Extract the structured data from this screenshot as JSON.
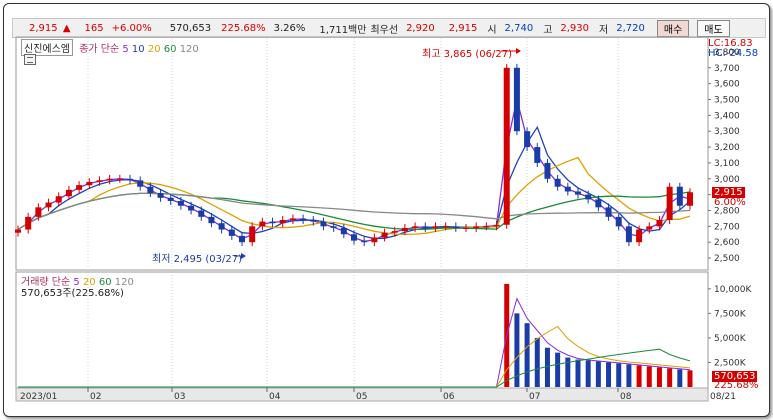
{
  "quote_bar": {
    "price": "2,915",
    "arrow": "▲",
    "change": "165",
    "change_pct": "+6.00%",
    "volume": "570,653",
    "volume_ratio": "225.68%",
    "turnover_pct": "3.26%",
    "amount": "1,711백만",
    "best_bid_label": "최우선",
    "best_ask": "2,920",
    "best_bid": "2,915",
    "open_label": "시",
    "open": "2,740",
    "high_label": "고",
    "high": "2,930",
    "low_label": "저",
    "low": "2,720",
    "buy_button": "매수",
    "sell_button": "매도"
  },
  "price_legend": {
    "stock_name": "신진에스엠",
    "ma_label": "종가 단순",
    "periods": [
      "5",
      "10",
      "20",
      "60",
      "120"
    ]
  },
  "lc_hc": {
    "lc": "LC:16.83",
    "hc": "HC:-24.58"
  },
  "annotations": {
    "high": "최고 3,865 (06/27)",
    "low": "최저 2,495 (03/27)"
  },
  "price_axis": {
    "ticks": [
      "3,800",
      "3,700",
      "3,600",
      "3,500",
      "3,400",
      "3,300",
      "3,200",
      "3,100",
      "3,000",
      "2,900",
      "2,800",
      "2,700",
      "2,600",
      "2,500"
    ],
    "current_price": "2,915",
    "current_pct": "6.00%"
  },
  "volume_legend": {
    "title": "거래량 단순",
    "periods": [
      "5",
      "20",
      "60",
      "120"
    ],
    "info": "570,653주(225.68%)"
  },
  "volume_axis": {
    "ticks": [
      "10,000K",
      "7,500K",
      "5,000K",
      "2,500K"
    ],
    "current_volume": "570,653",
    "current_pct": "225.68%"
  },
  "x_axis": {
    "ticks": [
      "2023/01",
      "02",
      "03",
      "04",
      "05",
      "06",
      "07",
      "08",
      "08/21"
    ]
  },
  "colors": {
    "up": "#d40000",
    "down": "#1a3ca6",
    "ma5": "#8a2be2",
    "ma10": "#2040c0",
    "ma20": "#e0a000",
    "ma60": "#1a8a3a",
    "ma120": "#888888"
  },
  "chart_data": {
    "type": "candlestick",
    "price_axis_range": [
      2450,
      3850
    ],
    "x_axis_range": [
      "2023/01",
      "08/21"
    ],
    "annotated_high": {
      "date": "06/27",
      "value": 3865
    },
    "annotated_low": {
      "date": "03/27",
      "value": 2495
    },
    "last_close": 2915,
    "last_volume": 570653,
    "volume_axis_range": [
      0,
      11000000
    ],
    "close_series": [
      2680,
      2760,
      2820,
      2850,
      2890,
      2930,
      2960,
      2980,
      2990,
      3000,
      3000,
      2990,
      2950,
      2910,
      2880,
      2860,
      2830,
      2800,
      2760,
      2720,
      2680,
      2640,
      2600,
      2700,
      2730,
      2720,
      2740,
      2750,
      2740,
      2730,
      2700,
      2690,
      2650,
      2610,
      2600,
      2630,
      2660,
      2670,
      2690,
      2700,
      2690,
      2700,
      2700,
      2690,
      2690,
      2700,
      2700,
      2710,
      3700,
      3300,
      3200,
      3100,
      3000,
      2950,
      2920,
      2900,
      2870,
      2820,
      2760,
      2700,
      2600,
      2680,
      2700,
      2740,
      2950,
      2830,
      2915
    ],
    "volume_series": [
      2,
      2,
      2,
      2,
      2,
      2,
      2,
      2,
      2,
      2,
      2,
      2,
      2,
      2,
      2,
      2,
      2,
      2,
      2,
      2,
      2,
      2,
      2,
      2,
      2,
      2,
      2,
      2,
      2,
      2,
      2,
      2,
      2,
      2,
      2,
      2,
      2,
      2,
      2,
      2,
      2,
      2,
      2,
      2,
      2,
      2,
      2,
      2,
      10500,
      7500,
      6500,
      5000,
      4000,
      3500,
      3000,
      2800,
      2700,
      2600,
      2500,
      2400,
      2300,
      2200,
      2100,
      2000,
      1900,
      1800,
      1700
    ]
  }
}
